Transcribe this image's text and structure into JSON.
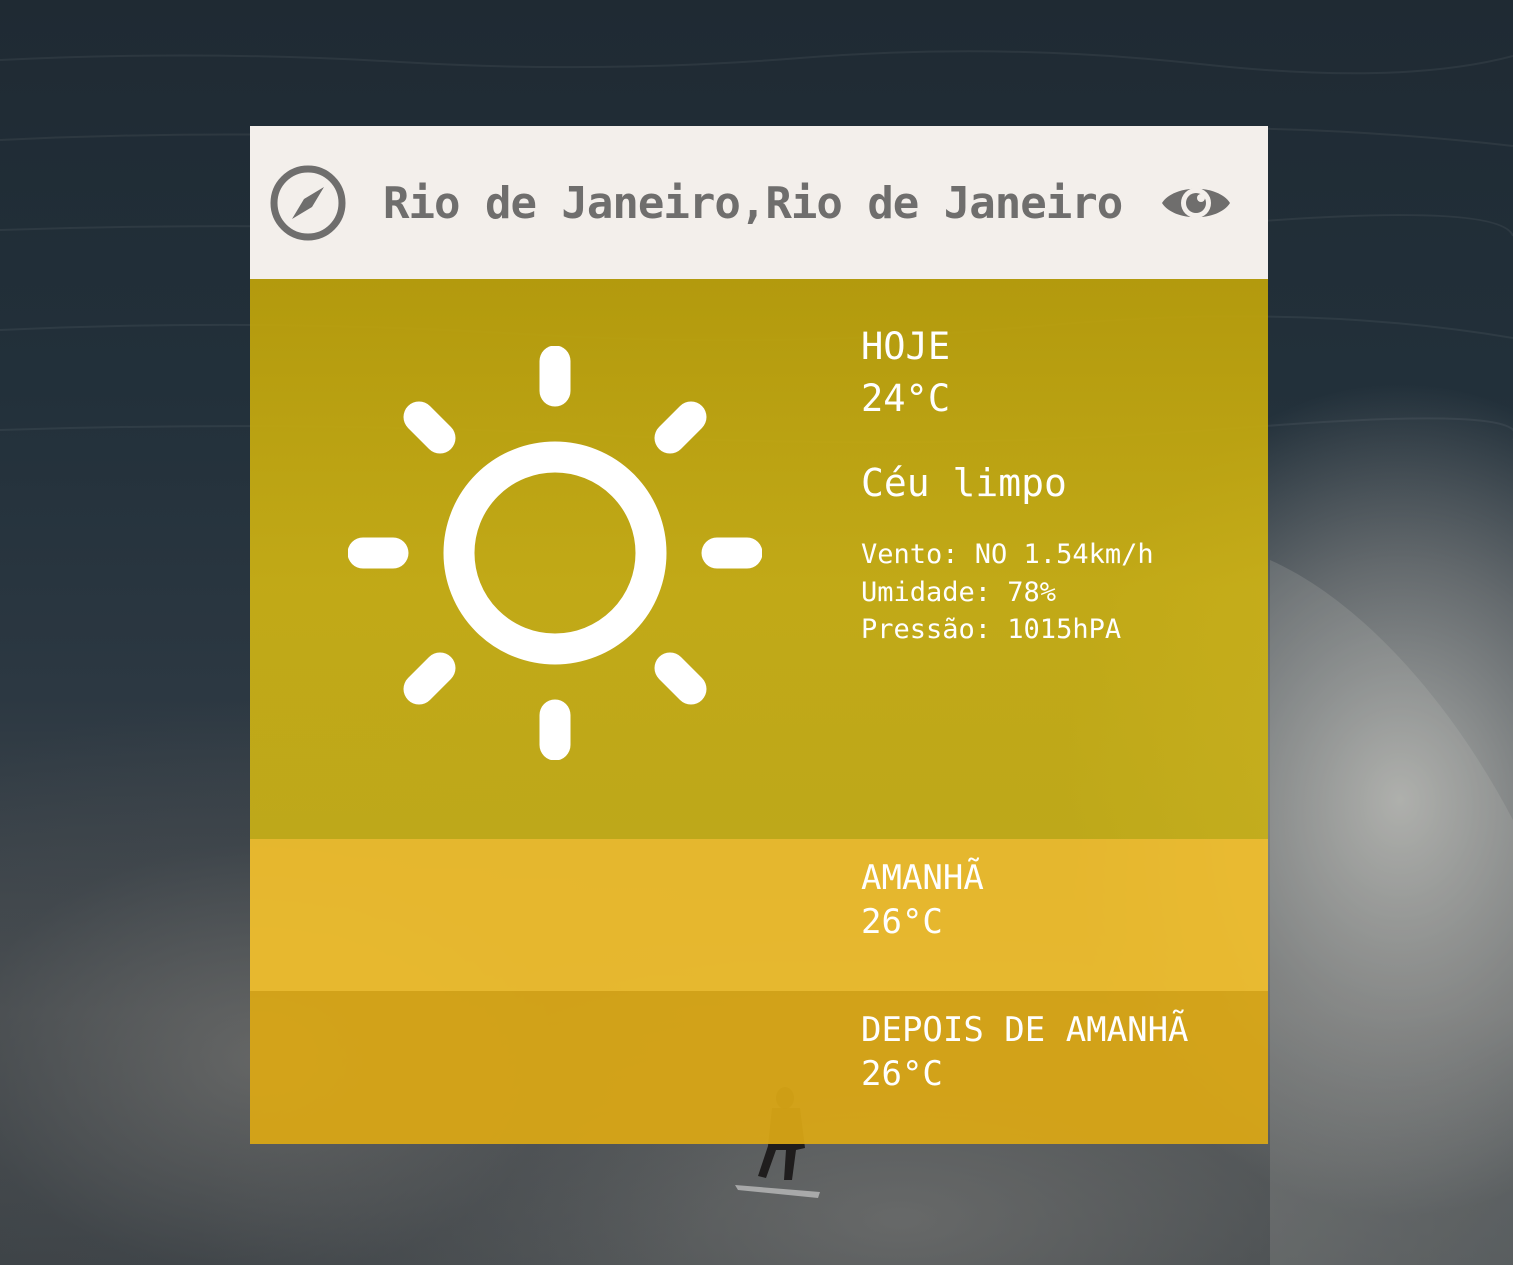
{
  "location": {
    "city": "Rio de Janeiro,Rio de Janeiro"
  },
  "icons": {
    "compass": "compass-icon",
    "eye": "eye-icon",
    "sun": "sun-icon"
  },
  "colors": {
    "header_bg": "#f3efeb",
    "header_text": "#6f6e6d",
    "today_bg": "#c9ac12",
    "tomorrow_bg": "#f0be2d",
    "after_bg": "#dca814",
    "text": "#ffffff"
  },
  "today": {
    "label": "HOJE",
    "temperature": "24°C",
    "condition": "Céu limpo",
    "wind": "Vento: NO 1.54km/h",
    "humidity": "Umidade: 78%",
    "pressure": "Pressão: 1015hPA"
  },
  "tomorrow": {
    "label": "AMANHÃ",
    "temperature": "26°C"
  },
  "day_after": {
    "label": "DEPOIS DE AMANHÃ",
    "temperature": "26°C"
  }
}
